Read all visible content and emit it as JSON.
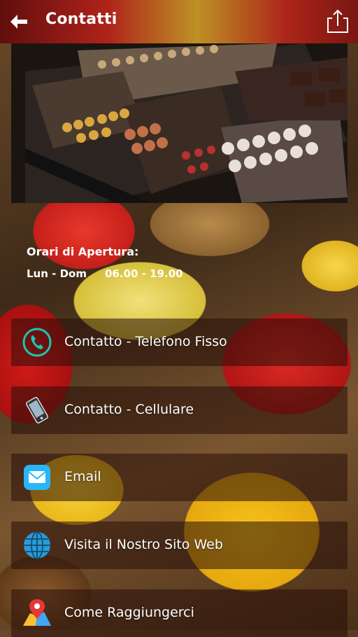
{
  "header": {
    "title": "Contatti"
  },
  "hours": {
    "title": "Orari di Apertura:",
    "days": "Lun - Dom",
    "time": "06.00 - 19.00"
  },
  "contacts": [
    {
      "label": "Contatto - Telefono Fisso",
      "icon": "phone-icon"
    },
    {
      "label": "Contatto - Cellulare",
      "icon": "mobile-phone-icon"
    },
    {
      "label": "Email",
      "icon": "mail-icon"
    },
    {
      "label": "Visita il Nostro Sito Web",
      "icon": "globe-icon"
    },
    {
      "label": "Come Raggiungerci",
      "icon": "map-pin-icon"
    }
  ],
  "colors": {
    "phone_ring": "#18c7b2",
    "mail_bg": "#29b6f6",
    "globe": "#2a9bd6",
    "pin": "#e53935"
  }
}
